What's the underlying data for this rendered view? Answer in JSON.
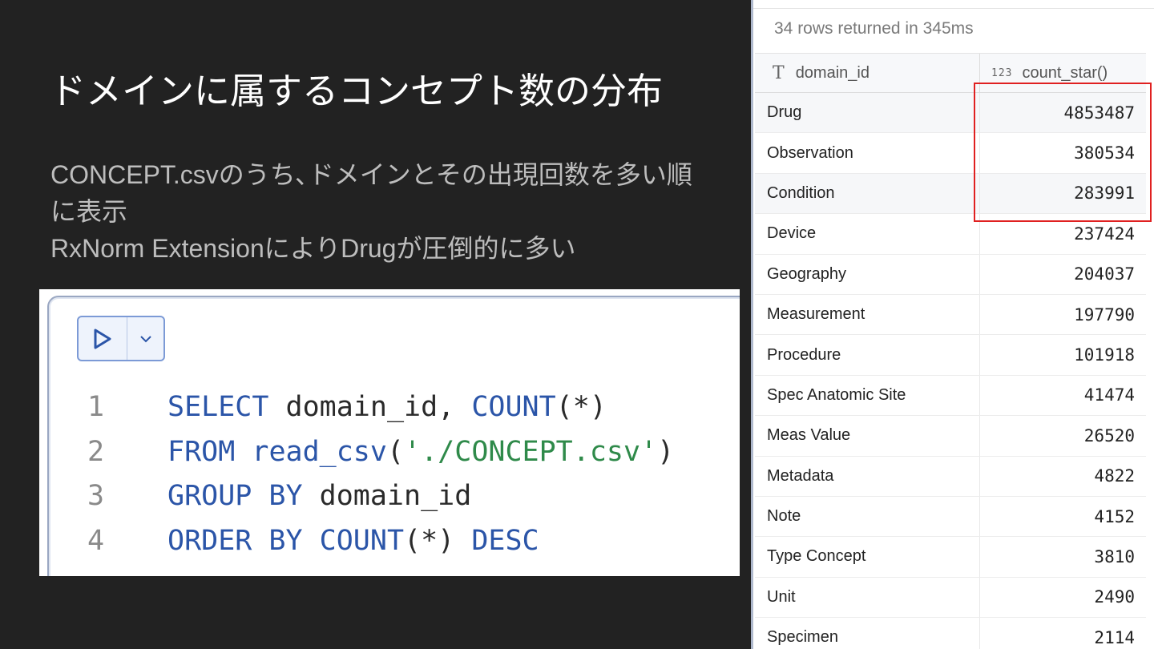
{
  "slide": {
    "title": "ドメインに属するコンセプト数の分布",
    "body_lines": [
      "CONCEPT.csvのうち､ドメインとその出現回数を多い順",
      "に表示",
      "RxNorm ExtensionによりDrugが圧倒的に多い"
    ]
  },
  "editor": {
    "code_lines": [
      {
        "num": "1",
        "tokens": [
          {
            "t": "SELECT",
            "c": "kw"
          },
          {
            "t": " domain_id, ",
            "c": "id"
          },
          {
            "t": "COUNT",
            "c": "kw"
          },
          {
            "t": "(*)",
            "c": "id"
          }
        ]
      },
      {
        "num": "2",
        "tokens": [
          {
            "t": "FROM",
            "c": "kw"
          },
          {
            "t": " ",
            "c": "id"
          },
          {
            "t": "read_csv",
            "c": "kw"
          },
          {
            "t": "(",
            "c": "id"
          },
          {
            "t": "'./CONCEPT.csv'",
            "c": "str"
          },
          {
            "t": ")",
            "c": "id"
          }
        ]
      },
      {
        "num": "3",
        "tokens": [
          {
            "t": "GROUP BY",
            "c": "kw"
          },
          {
            "t": " domain_id",
            "c": "id"
          }
        ]
      },
      {
        "num": "4",
        "tokens": [
          {
            "t": "ORDER BY",
            "c": "kw"
          },
          {
            "t": " ",
            "c": "id"
          },
          {
            "t": "COUNT",
            "c": "kw"
          },
          {
            "t": "(*) ",
            "c": "id"
          },
          {
            "t": "DESC",
            "c": "kw"
          }
        ]
      }
    ]
  },
  "results": {
    "status": "34 rows returned in 345ms",
    "columns": [
      {
        "type_icon": "T",
        "name": "domain_id"
      },
      {
        "type_icon": "123",
        "name": "count_star()"
      }
    ],
    "rows": [
      [
        "Drug",
        "4853487"
      ],
      [
        "Observation",
        "380534"
      ],
      [
        "Condition",
        "283991"
      ],
      [
        "Device",
        "237424"
      ],
      [
        "Geography",
        "204037"
      ],
      [
        "Measurement",
        "197790"
      ],
      [
        "Procedure",
        "101918"
      ],
      [
        "Spec Anatomic Site",
        "41474"
      ],
      [
        "Meas Value",
        "26520"
      ],
      [
        "Metadata",
        "4822"
      ],
      [
        "Note",
        "4152"
      ],
      [
        "Type Concept",
        "3810"
      ],
      [
        "Unit",
        "2490"
      ],
      [
        "Specimen",
        "2114"
      ]
    ],
    "highlight_color": "#e02020"
  }
}
